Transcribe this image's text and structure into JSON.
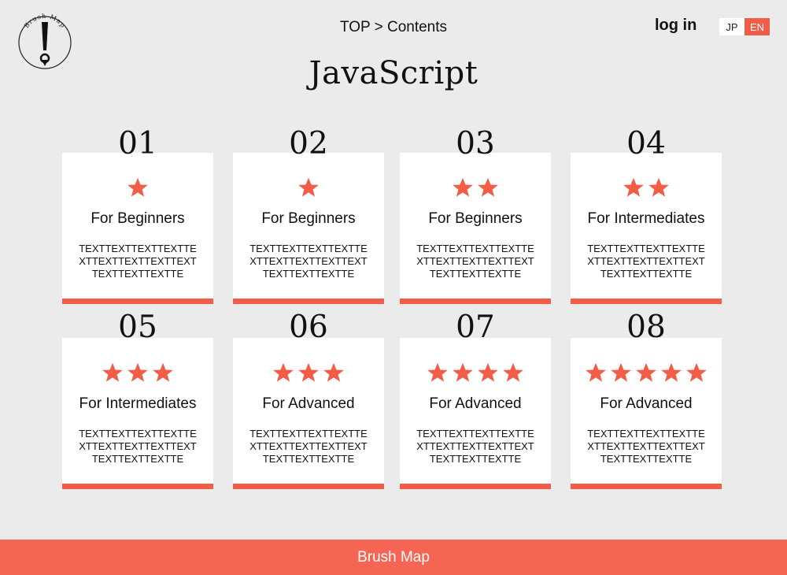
{
  "logo": {
    "text": "Brush Map"
  },
  "breadcrumb": {
    "top": "TOP",
    "separator": " > ",
    "current": "Contents"
  },
  "header": {
    "login_label": "log in",
    "lang_jp": "JP",
    "lang_en": "EN"
  },
  "page_title": "JavaScript",
  "accent_color": "#f25d47",
  "cards": [
    {
      "number": "01",
      "stars": 1,
      "level": "For Beginners",
      "text": "TEXTTEXTTEXTTEXTTEXTTEXTTEXTTEXTTEXTTEXTTEXTTEXTTE"
    },
    {
      "number": "02",
      "stars": 1,
      "level": "For Beginners",
      "text": "TEXTTEXTTEXTTEXTTEXTTEXTTEXTTEXTTEXTTEXTTEXTTEXTTE"
    },
    {
      "number": "03",
      "stars": 2,
      "level": "For Beginners",
      "text": "TEXTTEXTTEXTTEXTTEXTTEXTTEXTTEXTTEXTTEXTTEXTTEXTTE"
    },
    {
      "number": "04",
      "stars": 2,
      "level": "For Intermediates",
      "text": "TEXTTEXTTEXTTEXTTEXTTEXTTEXTTEXTTEXTTEXTTEXTTEXTTE"
    },
    {
      "number": "05",
      "stars": 3,
      "level": "For Intermediates",
      "text": "TEXTTEXTTEXTTEXTTEXTTEXTTEXTTEXTTEXTTEXTTEXTTEXTTE"
    },
    {
      "number": "06",
      "stars": 3,
      "level": "For Advanced",
      "text": "TEXTTEXTTEXTTEXTTEXTTEXTTEXTTEXTTEXTTEXTTEXTTEXTTE"
    },
    {
      "number": "07",
      "stars": 4,
      "level": "For Advanced",
      "text": "TEXTTEXTTEXTTEXTTEXTTEXTTEXTTEXTTEXTTEXTTEXTTEXTTE"
    },
    {
      "number": "08",
      "stars": 5,
      "level": "For Advanced",
      "text": "TEXTTEXTTEXTTEXTTEXTTEXTTEXTTEXTTEXTTEXTTEXTTEXTTE"
    }
  ],
  "footer": {
    "label": "Brush Map"
  }
}
